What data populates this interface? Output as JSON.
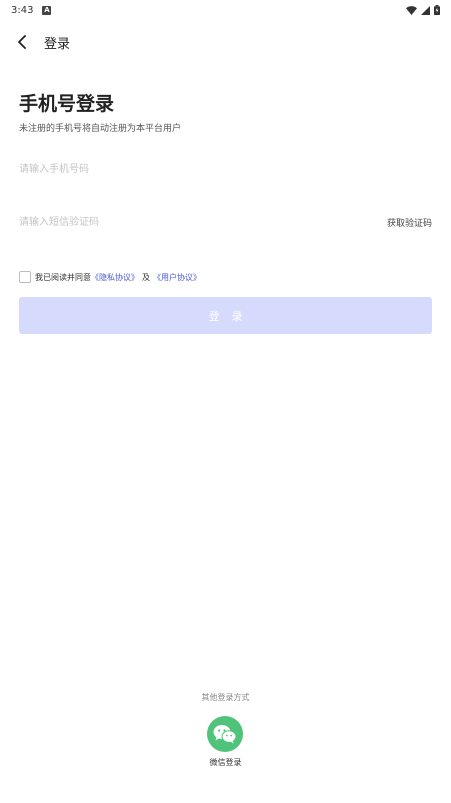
{
  "status_bar": {
    "time": "3:43",
    "notification": "A"
  },
  "header": {
    "title": "登录"
  },
  "login": {
    "heading": "手机号登录",
    "subtitle": "未注册的手机号将自动注册为本平台用户",
    "phone_placeholder": "请输入手机号码",
    "code_placeholder": "请输入短信验证码",
    "get_code_label": "获取验证码",
    "agreement": {
      "prefix": "我已阅读并同意",
      "privacy": "《隐私协议》",
      "and": "及",
      "user": "《用户协议》"
    },
    "button_label": "登录"
  },
  "other_login": {
    "label": "其他登录方式",
    "wechat_label": "微信登录"
  },
  "colors": {
    "accent": "#4a5bd6",
    "button_disabled": "#d6dafc",
    "wechat": "#4fc37a"
  }
}
